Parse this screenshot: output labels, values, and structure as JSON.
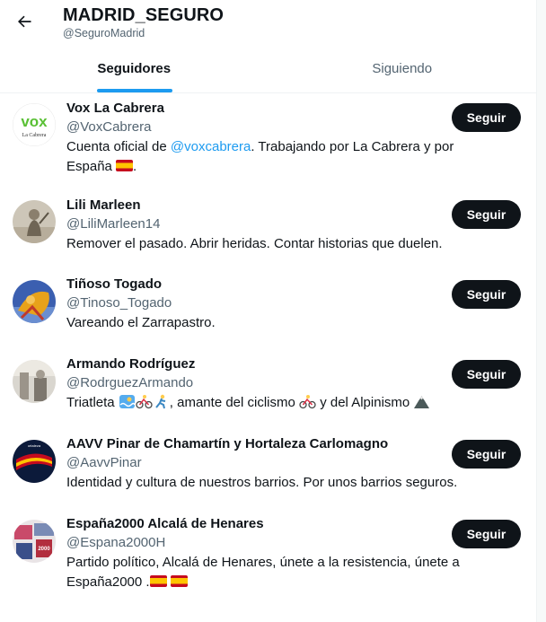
{
  "header": {
    "back_label": "Back",
    "title": "MADRID_SEGURO",
    "handle": "@SeguroMadrid"
  },
  "tabs": [
    {
      "label": "Seguidores",
      "active": true
    },
    {
      "label": "Siguiendo",
      "active": false
    }
  ],
  "follow_label": "Seguir",
  "users": [
    {
      "name": "Vox La Cabrera",
      "handle": "@VoxCabrera",
      "avatar": "vox-logo",
      "avatar_text": "La Cabrera",
      "bio_pre": "Cuenta oficial de ",
      "bio_mention": "@voxcabrera",
      "bio_post": ". Trabajando por La Cabrera y por",
      "bio_line2": "España "
    },
    {
      "name": "Lili Marleen",
      "handle": "@LiliMarleen14",
      "avatar": "sepia-photo",
      "bio": "Remover el pasado. Abrir heridas. Contar historias que duelen."
    },
    {
      "name": "Tiñoso Togado",
      "handle": "@Tinoso_Togado",
      "avatar": "cartoon-figure",
      "bio": "Vareando el Zarrapastro."
    },
    {
      "name": "Armando Rodríguez",
      "handle": "@RodrguezArmando",
      "avatar": "grey-photo",
      "bio_pre": "Triatleta ",
      "bio_mid": ",  amante del ciclismo ",
      "bio_post": " y del Alpinismo "
    },
    {
      "name": "AAVV Pinar de Chamartín y Hortaleza Carlomagno",
      "handle": "@AavvPinar",
      "avatar": "spain-flag-badge",
      "bio": "Identidad y cultura de nuestros barrios. Por unos barrios seguros."
    },
    {
      "name": "España2000 Alcalá de Henares",
      "handle": "@Espana2000H",
      "avatar": "poster-collage",
      "bio_line1": "Partido político, Alcalá de Henares, únete a la resistencia, únete a",
      "bio_line2": "España2000 ."
    }
  ],
  "colors": {
    "accent": "#1d9bf0",
    "text": "#0f1419",
    "secondary": "#536471",
    "button_bg": "#0f1419",
    "vox_green": "#5ac035"
  }
}
